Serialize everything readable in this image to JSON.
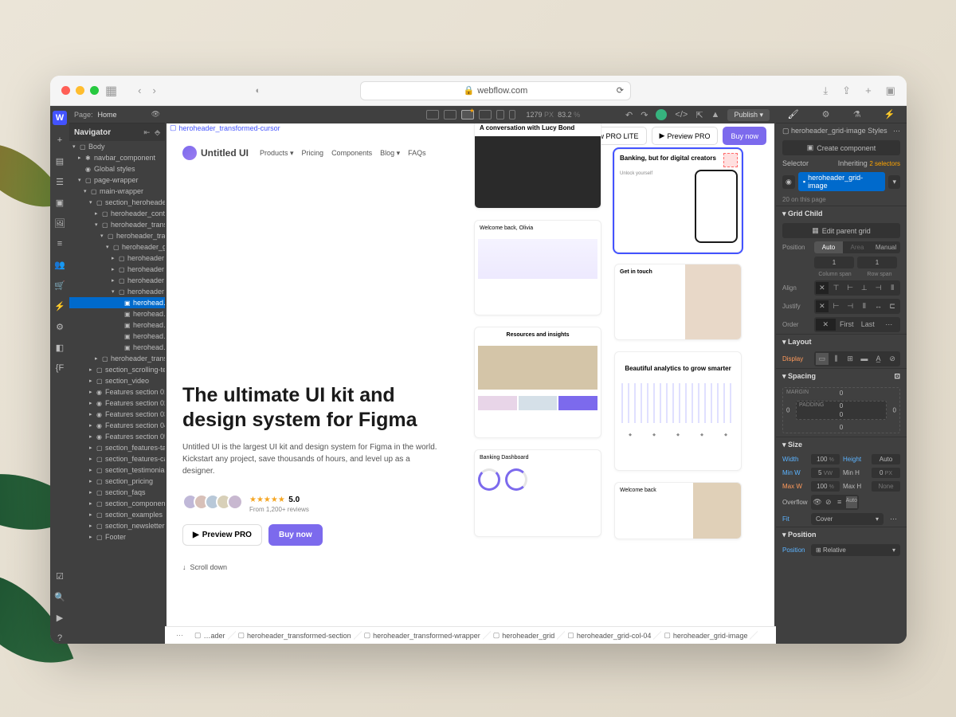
{
  "browser": {
    "url": "webflow.com"
  },
  "app_topbar": {
    "page_label": "Page:",
    "page_name": "Home",
    "zoom_px": "1279",
    "zoom_px_unit": "PX",
    "zoom_pct": "83.2",
    "zoom_pct_unit": "%",
    "publish": "Publish"
  },
  "navigator": {
    "title": "Navigator",
    "items": [
      {
        "icon": "▢",
        "label": "Body",
        "indent": 0,
        "caret": "▾"
      },
      {
        "icon": "✱",
        "label": "navbar_component",
        "indent": 1,
        "caret": "▸"
      },
      {
        "icon": "◉",
        "label": "Global styles",
        "indent": 1,
        "caret": ""
      },
      {
        "icon": "▢",
        "label": "page-wrapper",
        "indent": 1,
        "caret": "▾"
      },
      {
        "icon": "▢",
        "label": "main-wrapper",
        "indent": 2,
        "caret": "▾"
      },
      {
        "icon": "▢",
        "label": "section_heroheader",
        "indent": 3,
        "caret": "▾"
      },
      {
        "icon": "▢",
        "label": "heroheader_conten…",
        "indent": 4,
        "caret": "▸"
      },
      {
        "icon": "▢",
        "label": "heroheader_transfo…",
        "indent": 4,
        "caret": "▾"
      },
      {
        "icon": "▢",
        "label": "heroheader_tran…",
        "indent": 5,
        "caret": "▾"
      },
      {
        "icon": "▢",
        "label": "heroheader_gr…",
        "indent": 6,
        "caret": "▾"
      },
      {
        "icon": "▢",
        "label": "heroheader…",
        "indent": 7,
        "caret": "▸"
      },
      {
        "icon": "▢",
        "label": "heroheader…",
        "indent": 7,
        "caret": "▸"
      },
      {
        "icon": "▢",
        "label": "heroheader…",
        "indent": 7,
        "caret": "▸"
      },
      {
        "icon": "▢",
        "label": "heroheader…",
        "indent": 7,
        "caret": "▾"
      },
      {
        "icon": "▣",
        "label": "herohead…",
        "indent": 8,
        "caret": "",
        "selected": true
      },
      {
        "icon": "▣",
        "label": "herohead…",
        "indent": 8,
        "caret": ""
      },
      {
        "icon": "▣",
        "label": "herohead…",
        "indent": 8,
        "caret": ""
      },
      {
        "icon": "▣",
        "label": "herohead…",
        "indent": 8,
        "caret": ""
      },
      {
        "icon": "▣",
        "label": "herohead…",
        "indent": 8,
        "caret": ""
      },
      {
        "icon": "▢",
        "label": "heroheader_transfor…",
        "indent": 4,
        "caret": "▸"
      },
      {
        "icon": "▢",
        "label": "section_scrolling-text…",
        "indent": 3,
        "caret": "▸"
      },
      {
        "icon": "▢",
        "label": "section_video",
        "indent": 3,
        "caret": "▸"
      },
      {
        "icon": "◉",
        "label": "Features section 01",
        "indent": 3,
        "caret": "▸"
      },
      {
        "icon": "◉",
        "label": "Features section 02",
        "indent": 3,
        "caret": "▸"
      },
      {
        "icon": "◉",
        "label": "Features section 03",
        "indent": 3,
        "caret": "▸"
      },
      {
        "icon": "◉",
        "label": "Features section 04",
        "indent": 3,
        "caret": "▸"
      },
      {
        "icon": "◉",
        "label": "Features section 05",
        "indent": 3,
        "caret": "▸"
      },
      {
        "icon": "▢",
        "label": "section_features-tab…",
        "indent": 3,
        "caret": "▸"
      },
      {
        "icon": "▢",
        "label": "section_features-car…",
        "indent": 3,
        "caret": "▸"
      },
      {
        "icon": "▢",
        "label": "section_testimonials",
        "indent": 3,
        "caret": "▸"
      },
      {
        "icon": "▢",
        "label": "section_pricing",
        "indent": 3,
        "caret": "▸"
      },
      {
        "icon": "▢",
        "label": "section_faqs",
        "indent": 3,
        "caret": "▸"
      },
      {
        "icon": "▢",
        "label": "section_components",
        "indent": 3,
        "caret": "▸"
      },
      {
        "icon": "▢",
        "label": "section_examples",
        "indent": 3,
        "caret": "▸"
      },
      {
        "icon": "▢",
        "label": "section_newsletter",
        "indent": 3,
        "caret": "▸"
      },
      {
        "icon": "▢",
        "label": "Footer",
        "indent": 3,
        "caret": "▸"
      }
    ]
  },
  "canvas": {
    "selection_label": "heroheader_transformed-cursor",
    "selected_element_tag": "heroheader_grid-image",
    "logo_name": "Untitled UI",
    "nav": [
      "Products",
      "Pricing",
      "Components",
      "Blog",
      "FAQs"
    ],
    "top_buttons": {
      "lite": "Preview PRO LITE",
      "pro": "Preview PRO",
      "buy": "Buy now"
    },
    "hero_title_1": "The ultimate UI kit and",
    "hero_title_2": "design system for Figma",
    "hero_body": "Untitled UI is the largest UI kit and design system for Figma in the world. Kickstart any project, save thousands of hours, and level up as a designer.",
    "rating_value": "5.0",
    "rating_sub": "From 1,200+ reviews",
    "cta_preview": "Preview PRO",
    "cta_buy": "Buy now",
    "scroll_hint": "Scroll down",
    "cards": {
      "c1": "A conversation with Lucy Bond",
      "c2": "Welcome back, Olivia",
      "c3": "Resources and insights",
      "c4": "Banking Dashboard",
      "c5": "Banking, but for digital creators",
      "c6": "Unlock yourself",
      "c7": "Get in touch",
      "c8": "Beautiful analytics to grow smarter",
      "c9": "Welcome back"
    }
  },
  "breadcrumb": [
    "…ader",
    "heroheader_transformed-section",
    "heroheader_transformed-wrapper",
    "heroheader_grid",
    "heroheader_grid-col-04",
    "heroheader_grid-image"
  ],
  "styles": {
    "title_suffix": "Styles",
    "element_class": "heroheader_grid-image",
    "create_component": "Create component",
    "selector_label": "Selector",
    "inheriting": "Inheriting",
    "inheriting_count": "2 selectors",
    "on_page": "20 on this page",
    "grid_child": {
      "title": "Grid Child",
      "edit_parent": "Edit parent grid",
      "position_label": "Position",
      "position_opts": [
        "Auto",
        "Area",
        "Manual"
      ],
      "col_span_label": "Column span",
      "row_span_label": "Row span",
      "span_val": "1",
      "align_label": "Align",
      "justify_label": "Justify",
      "order_label": "Order",
      "order_first": "First",
      "order_last": "Last"
    },
    "layout": {
      "title": "Layout",
      "display_label": "Display"
    },
    "spacing": {
      "title": "Spacing",
      "margin_label": "MARGIN",
      "padding_label": "PADDING",
      "vals": {
        "t": "0",
        "r": "0",
        "b": "0",
        "l": "0",
        "pt": "0",
        "pr": "0",
        "pb": "0",
        "pl": "0"
      }
    },
    "size": {
      "title": "Size",
      "width_label": "Width",
      "width_val": "100",
      "width_unit": "%",
      "height_label": "Height",
      "height_val": "Auto",
      "minw_label": "Min W",
      "minw_val": "5",
      "minw_unit": "VW",
      "minh_label": "Min H",
      "minh_val": "0",
      "minh_unit": "PX",
      "maxw_label": "Max W",
      "maxw_val": "100",
      "maxw_unit": "%",
      "maxh_label": "Max H",
      "maxh_val": "None",
      "overflow_label": "Overflow",
      "overflow_val": "Auto",
      "fit_label": "Fit",
      "fit_val": "Cover"
    },
    "position": {
      "title": "Position",
      "label": "Position",
      "value": "Relative"
    }
  }
}
